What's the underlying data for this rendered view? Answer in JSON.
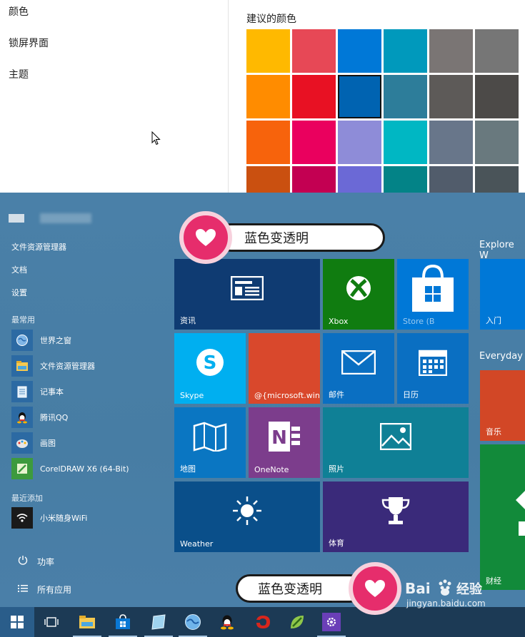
{
  "settings": {
    "menu": [
      "颜色",
      "锁屏界面",
      "主题"
    ],
    "colors_title": "建议的颜色",
    "swatches": [
      [
        "#FFB900",
        "#E74856",
        "#0078D7",
        "#0099BC",
        "#7A7574",
        "#767676"
      ],
      [
        "#FF8C00",
        "#E81123",
        "#0063B1",
        "#2D7D9A",
        "#5D5A58",
        "#4C4A48"
      ],
      [
        "#F7630C",
        "#EA005E",
        "#8E8CD8",
        "#00B7C3",
        "#68768A",
        "#69797E"
      ],
      [
        "#CA5010",
        "#C30052",
        "#6B69D6",
        "#038387",
        "#515C6B",
        "#4A5459"
      ]
    ],
    "selected_swatch": "#0063B1"
  },
  "start": {
    "places": [
      "文件资源管理器",
      "文档",
      "设置"
    ],
    "most_used_label": "最常用",
    "most_used": [
      {
        "label": "世界之窗",
        "icon": "globe-icon"
      },
      {
        "label": "文件资源管理器",
        "icon": "folder-icon"
      },
      {
        "label": "记事本",
        "icon": "notepad-icon"
      },
      {
        "label": "腾讯QQ",
        "icon": "qq-icon"
      },
      {
        "label": "画图",
        "icon": "paint-icon"
      },
      {
        "label": "CorelDRAW X6 (64-Bit)",
        "icon": "coreldraw-icon"
      }
    ],
    "recent_label": "最近添加",
    "recent": [
      {
        "label": "小米随身WiFi",
        "icon": "wifi-icon"
      }
    ],
    "power_label": "功率",
    "all_apps_label": "所有应用"
  },
  "tiles": {
    "news": "资讯",
    "xbox": "Xbox",
    "store": "Store (B",
    "skype": "Skype",
    "msn": "@{microsoft.win",
    "mail": "邮件",
    "calendar": "日历",
    "maps": "地图",
    "onenote": "OneNote",
    "photos": "照片",
    "weather": "Weather",
    "sports": "体育",
    "group_explore": "Explore W",
    "group_everyday": "Everyday",
    "intro": "入门",
    "music": "音乐",
    "finance": "财经"
  },
  "annotations": {
    "top": "蓝色变透明",
    "bottom": "蓝色变透明"
  },
  "watermark": {
    "brand": "Bai",
    "brand_cn": "经验",
    "url": "jingyan.baidu.com"
  },
  "colors": {
    "start_bg": "#4a80a8",
    "heart": "#e62d6c"
  }
}
